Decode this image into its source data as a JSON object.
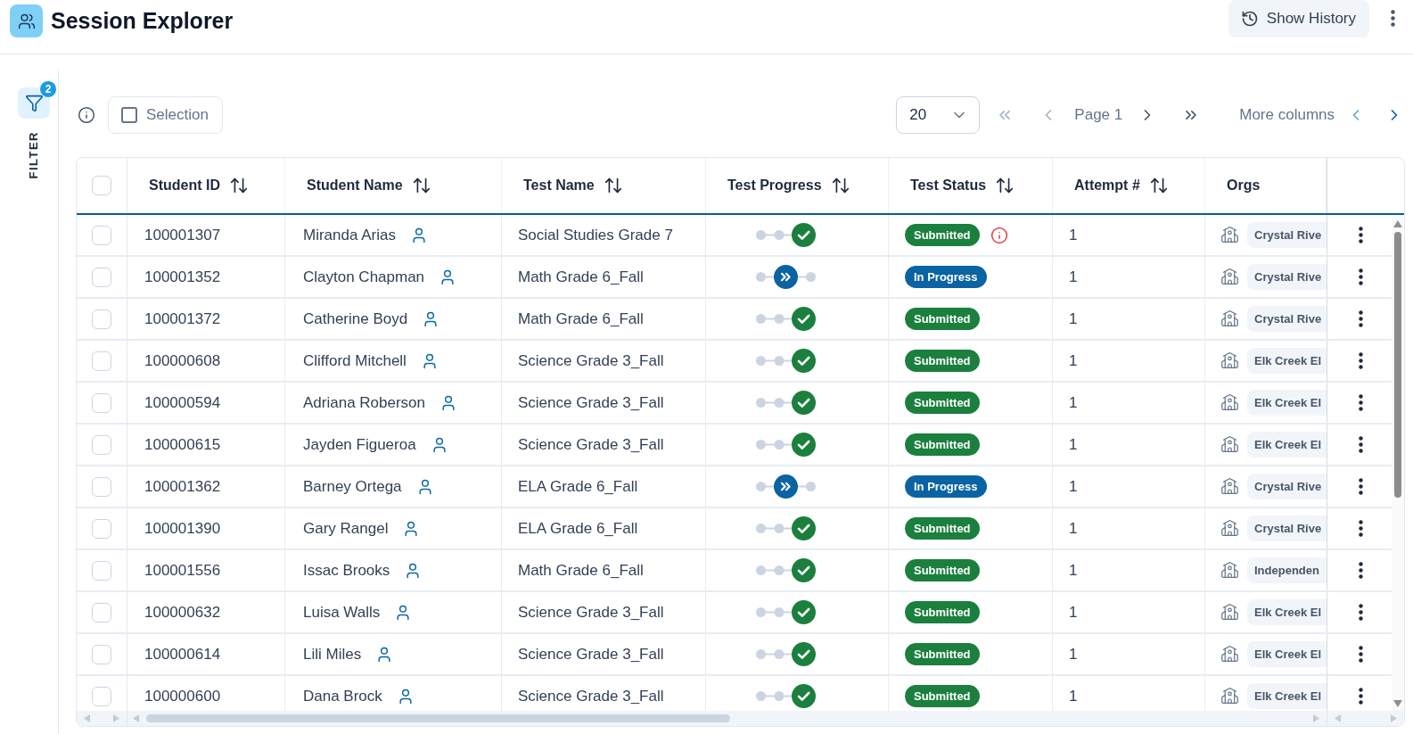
{
  "header": {
    "title": "Session Explorer",
    "history_button": "Show History"
  },
  "filter": {
    "label": "FILTER",
    "badge": "2"
  },
  "toolbar": {
    "selection": {
      "label": "Selection",
      "checked": false
    },
    "page_size": "20",
    "pagination": {
      "first": {
        "disabled": true
      },
      "previous": {
        "disabled": true
      },
      "page": "Page 1",
      "next": {
        "disabled": false
      },
      "last": {
        "disabled": false
      }
    },
    "column_nav": {
      "label": "More columns",
      "previous": {
        "disabled": true
      },
      "next": {
        "disabled": false
      }
    }
  },
  "table": {
    "select_all": {
      "checked": false
    },
    "columns": [
      {
        "label": "Student ID",
        "sortable": true
      },
      {
        "label": "Student Name",
        "sortable": true
      },
      {
        "label": "Test Name",
        "sortable": true
      },
      {
        "label": "Test Progress",
        "sortable": true
      },
      {
        "label": "Test Status",
        "sortable": true
      },
      {
        "label": "Attempt #",
        "sortable": true
      },
      {
        "label": "Orgs",
        "sortable": false
      }
    ],
    "rows": [
      {
        "checked": false,
        "student_id": "100001307",
        "student_name": "Miranda Arias",
        "test_name": "Social Studies Grade 7",
        "progress": {
          "kind": "complete"
        },
        "status": {
          "label": "Submitted",
          "kind": "submitted",
          "alert": true
        },
        "attempt": "1",
        "org": "Crystal Rive"
      },
      {
        "checked": false,
        "student_id": "100001352",
        "student_name": "Clayton Chapman",
        "test_name": "Math Grade 6_Fall",
        "progress": {
          "kind": "in_progress"
        },
        "status": {
          "label": "In Progress",
          "kind": "in_progress",
          "alert": false
        },
        "attempt": "1",
        "org": "Crystal Rive"
      },
      {
        "checked": false,
        "student_id": "100001372",
        "student_name": "Catherine Boyd",
        "test_name": "Math Grade 6_Fall",
        "progress": {
          "kind": "complete"
        },
        "status": {
          "label": "Submitted",
          "kind": "submitted",
          "alert": false
        },
        "attempt": "1",
        "org": "Crystal Rive"
      },
      {
        "checked": false,
        "student_id": "100000608",
        "student_name": "Clifford Mitchell",
        "test_name": "Science Grade 3_Fall",
        "progress": {
          "kind": "complete"
        },
        "status": {
          "label": "Submitted",
          "kind": "submitted",
          "alert": false
        },
        "attempt": "1",
        "org": "Elk Creek El"
      },
      {
        "checked": false,
        "student_id": "100000594",
        "student_name": "Adriana Roberson",
        "test_name": "Science Grade 3_Fall",
        "progress": {
          "kind": "complete"
        },
        "status": {
          "label": "Submitted",
          "kind": "submitted",
          "alert": false
        },
        "attempt": "1",
        "org": "Elk Creek El"
      },
      {
        "checked": false,
        "student_id": "100000615",
        "student_name": "Jayden Figueroa",
        "test_name": "Science Grade 3_Fall",
        "progress": {
          "kind": "complete"
        },
        "status": {
          "label": "Submitted",
          "kind": "submitted",
          "alert": false
        },
        "attempt": "1",
        "org": "Elk Creek El"
      },
      {
        "checked": false,
        "student_id": "100001362",
        "student_name": "Barney Ortega",
        "test_name": "ELA Grade 6_Fall",
        "progress": {
          "kind": "in_progress"
        },
        "status": {
          "label": "In Progress",
          "kind": "in_progress",
          "alert": false
        },
        "attempt": "1",
        "org": "Crystal Rive"
      },
      {
        "checked": false,
        "student_id": "100001390",
        "student_name": "Gary Rangel",
        "test_name": "ELA Grade 6_Fall",
        "progress": {
          "kind": "complete"
        },
        "status": {
          "label": "Submitted",
          "kind": "submitted",
          "alert": false
        },
        "attempt": "1",
        "org": "Crystal Rive"
      },
      {
        "checked": false,
        "student_id": "100001556",
        "student_name": "Issac Brooks",
        "test_name": "Math Grade 6_Fall",
        "progress": {
          "kind": "complete"
        },
        "status": {
          "label": "Submitted",
          "kind": "submitted",
          "alert": false
        },
        "attempt": "1",
        "org": "Independen"
      },
      {
        "checked": false,
        "student_id": "100000632",
        "student_name": "Luisa Walls",
        "test_name": "Science Grade 3_Fall",
        "progress": {
          "kind": "complete"
        },
        "status": {
          "label": "Submitted",
          "kind": "submitted",
          "alert": false
        },
        "attempt": "1",
        "org": "Elk Creek El"
      },
      {
        "checked": false,
        "student_id": "100000614",
        "student_name": "Lili Miles",
        "test_name": "Science Grade 3_Fall",
        "progress": {
          "kind": "complete"
        },
        "status": {
          "label": "Submitted",
          "kind": "submitted",
          "alert": false
        },
        "attempt": "1",
        "org": "Elk Creek El"
      },
      {
        "checked": false,
        "student_id": "100000600",
        "student_name": "Dana Brock",
        "test_name": "Science Grade 3_Fall",
        "progress": {
          "kind": "complete"
        },
        "status": {
          "label": "Submitted",
          "kind": "submitted",
          "alert": false
        },
        "attempt": "1",
        "org": "Elk Creek El"
      }
    ]
  }
}
